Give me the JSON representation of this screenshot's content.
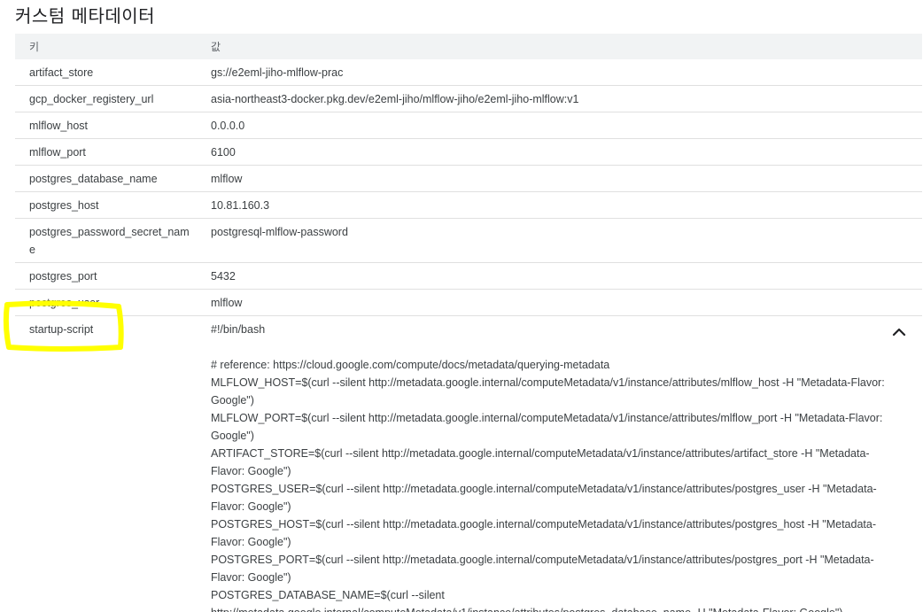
{
  "section": {
    "title": "커스텀 메타데이터"
  },
  "table": {
    "headers": {
      "key": "키",
      "value": "값"
    },
    "rows": [
      {
        "key": "artifact_store",
        "value": "gs://e2eml-jiho-mlflow-prac"
      },
      {
        "key": "gcp_docker_registery_url",
        "value": "asia-northeast3-docker.pkg.dev/e2eml-jiho/mlflow-jiho/e2eml-jiho-mlflow:v1"
      },
      {
        "key": "mlflow_host",
        "value": "0.0.0.0"
      },
      {
        "key": "mlflow_port",
        "value": "6100"
      },
      {
        "key": "postgres_database_name",
        "value": "mlflow"
      },
      {
        "key": "postgres_host",
        "value": "10.81.160.3"
      },
      {
        "key": "postgres_password_secret_name",
        "value": "postgresql-mlflow-password"
      },
      {
        "key": "postgres_port",
        "value": "5432"
      },
      {
        "key": "postgres_user",
        "value": "mlflow"
      }
    ],
    "startup": {
      "key": "startup-script",
      "lines": [
        "#!/bin/bash",
        "",
        "# reference: https://cloud.google.com/compute/docs/metadata/querying-metadata",
        "MLFLOW_HOST=$(curl --silent http://metadata.google.internal/computeMetadata/v1/instance/attributes/mlflow_host -H \"Metadata-Flavor: Google\")",
        "MLFLOW_PORT=$(curl --silent http://metadata.google.internal/computeMetadata/v1/instance/attributes/mlflow_port -H \"Metadata-Flavor: Google\")",
        "ARTIFACT_STORE=$(curl --silent http://metadata.google.internal/computeMetadata/v1/instance/attributes/artifact_store -H \"Metadata-Flavor: Google\")",
        "POSTGRES_USER=$(curl --silent http://metadata.google.internal/computeMetadata/v1/instance/attributes/postgres_user -H \"Metadata-Flavor: Google\")",
        "POSTGRES_HOST=$(curl --silent http://metadata.google.internal/computeMetadata/v1/instance/attributes/postgres_host -H \"Metadata-Flavor: Google\")",
        "POSTGRES_PORT=$(curl --silent http://metadata.google.internal/computeMetadata/v1/instance/attributes/postgres_port -H \"Metadata-Flavor: Google\")",
        "POSTGRES_DATABASE_NAME=$(curl --silent http://metadata.google.internal/computeMetadata/v1/instance/attributes/postgres_database_name -H \"Metadata-Flavor: Google\")"
      ],
      "collapse_icon": "chevron-up-icon"
    }
  },
  "colors": {
    "highlight": "#ffff00",
    "header_bg": "#f1f3f4",
    "divider": "#e0e0e0"
  }
}
